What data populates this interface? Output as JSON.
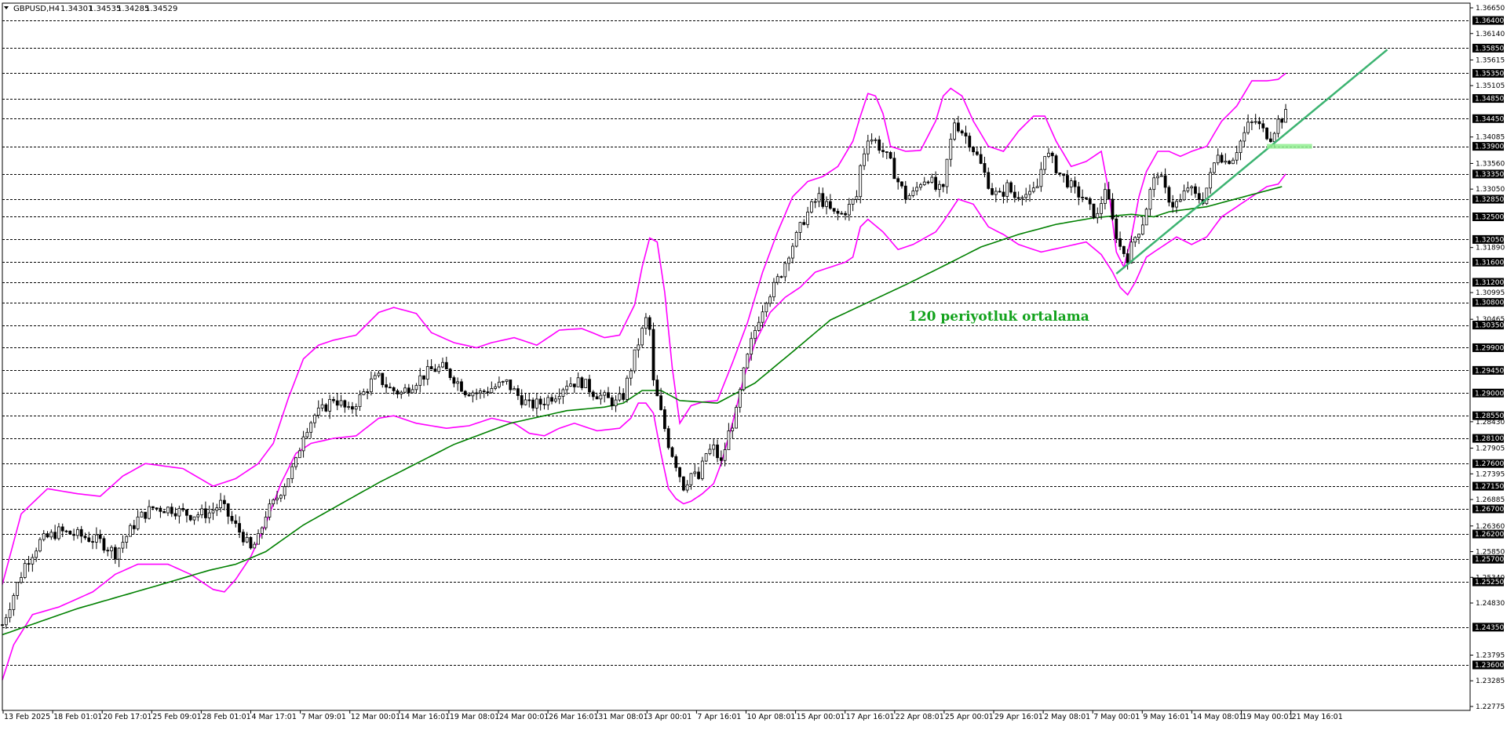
{
  "header": {
    "symbol": "GBPUSD,H4",
    "open": "1.34301",
    "high": "1.34535",
    "low": "1.34285",
    "close": "1.34529"
  },
  "annotation": "120 periyotluk ortalama",
  "colors": {
    "background": "#ffffff",
    "candle": "#000000",
    "bollinger": "#ff00ff",
    "moving_average": "#008000",
    "trendline": "#3cb371",
    "support_marker": "#90ee90",
    "level_tag_bg": "#000000"
  },
  "chart_data": {
    "type": "candlestick",
    "title": "GBPUSD,H4",
    "ylim": [
      1.22775,
      1.3665
    ],
    "grid": false,
    "x_tick_labels": [
      "13 Feb 2025",
      "18 Feb 01:01",
      "20 Feb 17:01",
      "25 Feb 09:01",
      "28 Feb 01:01",
      "4 Mar 17:01",
      "7 Mar 09:01",
      "12 Mar 00:01",
      "14 Mar 16:01",
      "19 Mar 08:01",
      "24 Mar 00:01",
      "26 Mar 16:01",
      "31 Mar 08:01",
      "3 Apr 00:01",
      "7 Apr 16:01",
      "10 Apr 08:01",
      "15 Apr 00:01",
      "17 Apr 16:01",
      "22 Apr 08:01",
      "25 Apr 00:01",
      "29 Apr 16:01",
      "2 May 08:01",
      "7 May 00:01",
      "9 May 16:01",
      "14 May 08:01",
      "19 May 00:01",
      "21 May 16:01"
    ],
    "y_ticks": [
      "1.36650",
      "1.36140",
      "1.35615",
      "1.35105",
      "1.34085",
      "1.33560",
      "1.33050",
      "1.31890",
      "1.30995",
      "1.30465",
      "1.28430",
      "1.27905",
      "1.27395",
      "1.26885",
      "1.26360",
      "1.25850",
      "1.25340",
      "1.24830",
      "1.23795",
      "1.23285",
      "1.22775"
    ],
    "horizontal_levels": [
      "1.36400",
      "1.35850",
      "1.35350",
      "1.34850",
      "1.34450",
      "1.33900",
      "1.33350",
      "1.32850",
      "1.32500",
      "1.32050",
      "1.31600",
      "1.31200",
      "1.30800",
      "1.30350",
      "1.29900",
      "1.29450",
      "1.29000",
      "1.28550",
      "1.28100",
      "1.27600",
      "1.27150",
      "1.26700",
      "1.26200",
      "1.25700",
      "1.25250",
      "1.24350",
      "1.23600"
    ],
    "price_path": [
      [
        0,
        1.244
      ],
      [
        3,
        1.25
      ],
      [
        6,
        1.256
      ],
      [
        10,
        1.2605
      ],
      [
        15,
        1.2625
      ],
      [
        20,
        1.2618
      ],
      [
        26,
        1.2605
      ],
      [
        30,
        1.2582
      ],
      [
        36,
        1.265
      ],
      [
        40,
        1.2672
      ],
      [
        45,
        1.267
      ],
      [
        50,
        1.2658
      ],
      [
        55,
        1.2662
      ],
      [
        58,
        1.268
      ],
      [
        61,
        1.2645
      ],
      [
        64,
        1.2615
      ],
      [
        66,
        1.2588
      ],
      [
        68,
        1.261
      ],
      [
        70,
        1.266
      ],
      [
        72,
        1.268
      ],
      [
        75,
        1.272
      ],
      [
        78,
        1.2762
      ],
      [
        80,
        1.2822
      ],
      [
        83,
        1.2856
      ],
      [
        85,
        1.2866
      ],
      [
        88,
        1.289
      ],
      [
        90,
        1.2878
      ],
      [
        92,
        1.2862
      ],
      [
        94,
        1.2882
      ],
      [
        96,
        1.29
      ],
      [
        98,
        1.2922
      ],
      [
        100,
        1.293
      ],
      [
        103,
        1.2908
      ],
      [
        106,
        1.29
      ],
      [
        110,
        1.2925
      ],
      [
        114,
        1.2946
      ],
      [
        117,
        1.295
      ],
      [
        120,
        1.293
      ],
      [
        123,
        1.2905
      ],
      [
        127,
        1.29
      ],
      [
        130,
        1.291
      ],
      [
        134,
        1.292
      ],
      [
        137,
        1.2895
      ],
      [
        140,
        1.2875
      ],
      [
        143,
        1.288
      ],
      [
        147,
        1.2898
      ],
      [
        150,
        1.292
      ],
      [
        154,
        1.2922
      ],
      [
        157,
        1.2902
      ],
      [
        160,
        1.289
      ],
      [
        163,
        1.288
      ],
      [
        165,
        1.2895
      ],
      [
        167,
        1.295
      ],
      [
        169,
        1.3
      ],
      [
        171,
        1.3045
      ],
      [
        172,
        1.3025
      ],
      [
        173,
        1.292
      ],
      [
        175,
        1.286
      ],
      [
        177,
        1.28
      ],
      [
        179,
        1.276
      ],
      [
        181,
        1.2715
      ],
      [
        183,
        1.274
      ],
      [
        185,
        1.273
      ],
      [
        187,
        1.278
      ],
      [
        189,
        1.279
      ],
      [
        191,
        1.276
      ],
      [
        193,
        1.282
      ],
      [
        195,
        1.286
      ],
      [
        197,
        1.294
      ],
      [
        199,
        1.3
      ],
      [
        201,
        1.305
      ],
      [
        203,
        1.309
      ],
      [
        205,
        1.311
      ],
      [
        207,
        1.314
      ],
      [
        209,
        1.318
      ],
      [
        211,
        1.321
      ],
      [
        213,
        1.3245
      ],
      [
        215,
        1.327
      ],
      [
        217,
        1.329
      ],
      [
        219,
        1.327
      ],
      [
        221,
        1.3255
      ],
      [
        223,
        1.3255
      ],
      [
        225,
        1.327
      ],
      [
        227,
        1.329
      ],
      [
        228,
        1.335
      ],
      [
        230,
        1.341
      ],
      [
        232,
        1.34
      ],
      [
        234,
        1.338
      ],
      [
        236,
        1.3355
      ],
      [
        238,
        1.332
      ],
      [
        240,
        1.329
      ],
      [
        242,
        1.3295
      ],
      [
        244,
        1.332
      ],
      [
        246,
        1.333
      ],
      [
        248,
        1.3305
      ],
      [
        250,
        1.33
      ],
      [
        251,
        1.336
      ],
      [
        253,
        1.344
      ],
      [
        255,
        1.342
      ],
      [
        257,
        1.34
      ],
      [
        259,
        1.337
      ],
      [
        261,
        1.3335
      ],
      [
        263,
        1.33
      ],
      [
        265,
        1.329
      ],
      [
        267,
        1.331
      ],
      [
        269,
        1.329
      ],
      [
        271,
        1.33
      ],
      [
        273,
        1.329
      ],
      [
        275,
        1.331
      ],
      [
        277,
        1.338
      ],
      [
        279,
        1.336
      ],
      [
        281,
        1.3335
      ],
      [
        283,
        1.332
      ],
      [
        285,
        1.33
      ],
      [
        287,
        1.329
      ],
      [
        289,
        1.3265
      ],
      [
        291,
        1.325
      ],
      [
        293,
        1.331
      ],
      [
        295,
        1.324
      ],
      [
        297,
        1.319
      ],
      [
        299,
        1.317
      ],
      [
        301,
        1.321
      ],
      [
        303,
        1.324
      ],
      [
        305,
        1.33
      ],
      [
        307,
        1.334
      ],
      [
        309,
        1.33
      ],
      [
        311,
        1.3275
      ],
      [
        313,
        1.328
      ],
      [
        315,
        1.331
      ],
      [
        317,
        1.329
      ],
      [
        319,
        1.3285
      ],
      [
        321,
        1.333
      ],
      [
        323,
        1.338
      ],
      [
        325,
        1.336
      ],
      [
        327,
        1.337
      ],
      [
        329,
        1.34
      ],
      [
        331,
        1.343
      ],
      [
        333,
        1.344
      ],
      [
        335,
        1.342
      ],
      [
        337,
        1.341
      ],
      [
        339,
        1.344
      ],
      [
        341,
        1.3453
      ]
    ],
    "moving_average_120": [
      [
        0,
        1.242
      ],
      [
        20,
        1.2472
      ],
      [
        40,
        1.2515
      ],
      [
        55,
        1.2548
      ],
      [
        62,
        1.256
      ],
      [
        70,
        1.2585
      ],
      [
        80,
        1.2638
      ],
      [
        100,
        1.2722
      ],
      [
        120,
        1.2798
      ],
      [
        135,
        1.284
      ],
      [
        150,
        1.2865
      ],
      [
        160,
        1.2872
      ],
      [
        165,
        1.288
      ],
      [
        170,
        1.2905
      ],
      [
        175,
        1.2905
      ],
      [
        180,
        1.2885
      ],
      [
        190,
        1.288
      ],
      [
        200,
        1.292
      ],
      [
        210,
        1.2982
      ],
      [
        220,
        1.3045
      ],
      [
        230,
        1.308
      ],
      [
        240,
        1.3115
      ],
      [
        250,
        1.3152
      ],
      [
        260,
        1.319
      ],
      [
        270,
        1.3215
      ],
      [
        280,
        1.3235
      ],
      [
        290,
        1.3248
      ],
      [
        300,
        1.3255
      ],
      [
        306,
        1.325
      ],
      [
        310,
        1.326
      ],
      [
        320,
        1.327
      ],
      [
        330,
        1.329
      ],
      [
        340,
        1.331
      ]
    ],
    "bollinger_upper": [
      [
        0,
        1.252
      ],
      [
        5,
        1.266
      ],
      [
        12,
        1.271
      ],
      [
        20,
        1.27
      ],
      [
        26,
        1.2695
      ],
      [
        32,
        1.2735
      ],
      [
        38,
        1.276
      ],
      [
        48,
        1.275
      ],
      [
        56,
        1.2715
      ],
      [
        62,
        1.273
      ],
      [
        68,
        1.276
      ],
      [
        72,
        1.28
      ],
      [
        76,
        1.289
      ],
      [
        80,
        1.2968
      ],
      [
        84,
        1.2995
      ],
      [
        88,
        1.3005
      ],
      [
        94,
        1.3015
      ],
      [
        100,
        1.306
      ],
      [
        104,
        1.307
      ],
      [
        110,
        1.3058
      ],
      [
        114,
        1.302
      ],
      [
        120,
        1.3
      ],
      [
        126,
        1.299
      ],
      [
        130,
        1.3
      ],
      [
        136,
        1.301
      ],
      [
        142,
        1.2995
      ],
      [
        148,
        1.3025
      ],
      [
        154,
        1.3028
      ],
      [
        160,
        1.301
      ],
      [
        164,
        1.3015
      ],
      [
        168,
        1.3075
      ],
      [
        170,
        1.315
      ],
      [
        172,
        1.3208
      ],
      [
        174,
        1.32
      ],
      [
        176,
        1.31
      ],
      [
        178,
        1.295
      ],
      [
        180,
        1.284
      ],
      [
        183,
        1.2875
      ],
      [
        186,
        1.2882
      ],
      [
        190,
        1.2885
      ],
      [
        194,
        1.296
      ],
      [
        198,
        1.304
      ],
      [
        202,
        1.314
      ],
      [
        206,
        1.322
      ],
      [
        210,
        1.329
      ],
      [
        214,
        1.332
      ],
      [
        218,
        1.333
      ],
      [
        222,
        1.335
      ],
      [
        226,
        1.34
      ],
      [
        228,
        1.345
      ],
      [
        230,
        1.3495
      ],
      [
        232,
        1.349
      ],
      [
        234,
        1.3455
      ],
      [
        236,
        1.339
      ],
      [
        240,
        1.338
      ],
      [
        244,
        1.3382
      ],
      [
        248,
        1.344
      ],
      [
        250,
        1.349
      ],
      [
        252,
        1.3505
      ],
      [
        255,
        1.349
      ],
      [
        258,
        1.344
      ],
      [
        262,
        1.339
      ],
      [
        266,
        1.338
      ],
      [
        270,
        1.342
      ],
      [
        274,
        1.345
      ],
      [
        277,
        1.345
      ],
      [
        280,
        1.34
      ],
      [
        284,
        1.335
      ],
      [
        288,
        1.336
      ],
      [
        292,
        1.338
      ],
      [
        294,
        1.33
      ],
      [
        296,
        1.318
      ],
      [
        298,
        1.315
      ],
      [
        300,
        1.321
      ],
      [
        302,
        1.329
      ],
      [
        304,
        1.334
      ],
      [
        307,
        1.338
      ],
      [
        310,
        1.338
      ],
      [
        313,
        1.337
      ],
      [
        316,
        1.338
      ],
      [
        320,
        1.339
      ],
      [
        324,
        1.344
      ],
      [
        328,
        1.347
      ],
      [
        332,
        1.352
      ],
      [
        336,
        1.352
      ],
      [
        339,
        1.3523
      ],
      [
        341,
        1.3535
      ]
    ],
    "bollinger_lower": [
      [
        0,
        1.233
      ],
      [
        3,
        1.24
      ],
      [
        8,
        1.246
      ],
      [
        15,
        1.2475
      ],
      [
        24,
        1.2505
      ],
      [
        30,
        1.254
      ],
      [
        36,
        1.256
      ],
      [
        44,
        1.256
      ],
      [
        50,
        1.254
      ],
      [
        56,
        1.251
      ],
      [
        59,
        1.2505
      ],
      [
        62,
        1.253
      ],
      [
        66,
        1.2575
      ],
      [
        70,
        1.264
      ],
      [
        74,
        1.272
      ],
      [
        78,
        1.278
      ],
      [
        82,
        1.28
      ],
      [
        88,
        1.281
      ],
      [
        94,
        1.2815
      ],
      [
        100,
        1.285
      ],
      [
        104,
        1.2855
      ],
      [
        110,
        1.284
      ],
      [
        118,
        1.283
      ],
      [
        124,
        1.2835
      ],
      [
        130,
        1.285
      ],
      [
        136,
        1.284
      ],
      [
        140,
        1.282
      ],
      [
        144,
        1.2815
      ],
      [
        148,
        1.283
      ],
      [
        152,
        1.284
      ],
      [
        158,
        1.2825
      ],
      [
        164,
        1.283
      ],
      [
        167,
        1.285
      ],
      [
        169,
        1.288
      ],
      [
        171,
        1.288
      ],
      [
        173,
        1.286
      ],
      [
        175,
        1.278
      ],
      [
        177,
        1.271
      ],
      [
        179,
        1.269
      ],
      [
        181,
        1.268
      ],
      [
        183,
        1.2685
      ],
      [
        186,
        1.27
      ],
      [
        189,
        1.272
      ],
      [
        191,
        1.276
      ],
      [
        194,
        1.284
      ],
      [
        197,
        1.293
      ],
      [
        200,
        1.3
      ],
      [
        204,
        1.306
      ],
      [
        208,
        1.309
      ],
      [
        212,
        1.311
      ],
      [
        216,
        1.314
      ],
      [
        220,
        1.315
      ],
      [
        224,
        1.316
      ],
      [
        226,
        1.317
      ],
      [
        228,
        1.323
      ],
      [
        230,
        1.3245
      ],
      [
        234,
        1.322
      ],
      [
        238,
        1.3185
      ],
      [
        242,
        1.3195
      ],
      [
        248,
        1.322
      ],
      [
        250,
        1.324
      ],
      [
        254,
        1.3285
      ],
      [
        258,
        1.3275
      ],
      [
        262,
        1.323
      ],
      [
        266,
        1.3215
      ],
      [
        270,
        1.3195
      ],
      [
        276,
        1.318
      ],
      [
        282,
        1.319
      ],
      [
        288,
        1.32
      ],
      [
        292,
        1.3175
      ],
      [
        295,
        1.314
      ],
      [
        297,
        1.311
      ],
      [
        299,
        1.3095
      ],
      [
        301,
        1.312
      ],
      [
        304,
        1.317
      ],
      [
        308,
        1.319
      ],
      [
        312,
        1.321
      ],
      [
        316,
        1.3195
      ],
      [
        320,
        1.321
      ],
      [
        324,
        1.325
      ],
      [
        328,
        1.327
      ],
      [
        332,
        1.329
      ],
      [
        336,
        1.331
      ],
      [
        339,
        1.3315
      ],
      [
        341,
        1.3335
      ]
    ],
    "trendline": [
      [
        296,
        1.3137
      ],
      [
        368,
        1.3582
      ]
    ],
    "support_zone": [
      [
        336,
        1.339
      ],
      [
        348,
        1.339
      ]
    ]
  }
}
